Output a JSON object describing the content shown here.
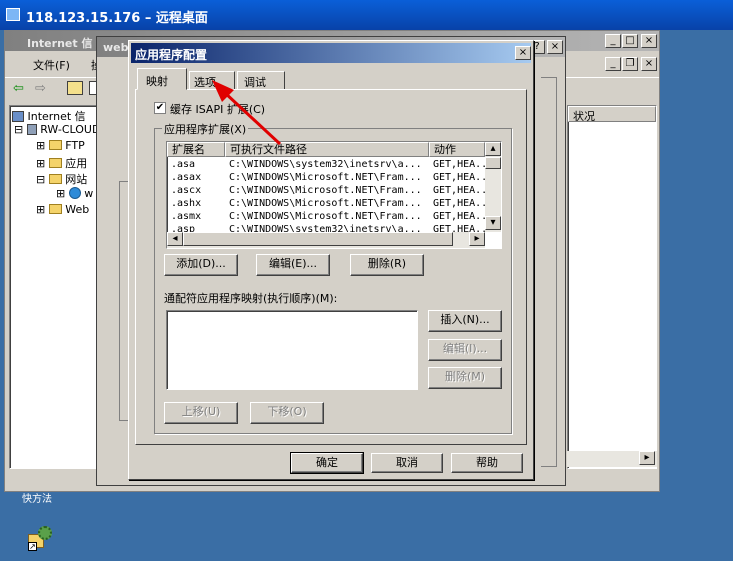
{
  "rdp": {
    "title": "118.123.15.176 – 远程桌面"
  },
  "iis": {
    "title": "Internet 信",
    "menu": {
      "file": "文件(F)",
      "action": "操"
    },
    "tree": [
      {
        "label": "Internet 信"
      },
      {
        "label": "RW-CLOUD"
      },
      {
        "label": "FTP"
      },
      {
        "label": "应用"
      },
      {
        "label": "网站"
      },
      {
        "label": "w"
      },
      {
        "label": "Web"
      }
    ],
    "status_col": "状况"
  },
  "props": {
    "title": "web"
  },
  "desktop": {
    "icon_label": "快方法"
  },
  "dialog": {
    "title": "应用程序配置",
    "tabs": [
      {
        "label": "映射"
      },
      {
        "label": "选项"
      },
      {
        "label": "调试"
      }
    ],
    "cache_label": "缓存 ISAPI 扩展(C)",
    "ext_group": "应用程序扩展(X)",
    "columns": {
      "ext": "扩展名",
      "path": "可执行文件路径",
      "verb": "动作"
    },
    "rows": [
      {
        "ext": ".asa",
        "path": "C:\\WINDOWS\\system32\\inetsrv\\a...",
        "verb": "GET,HEA..."
      },
      {
        "ext": ".asax",
        "path": "C:\\WINDOWS\\Microsoft.NET\\Fram...",
        "verb": "GET,HEA..."
      },
      {
        "ext": ".ascx",
        "path": "C:\\WINDOWS\\Microsoft.NET\\Fram...",
        "verb": "GET,HEA..."
      },
      {
        "ext": ".ashx",
        "path": "C:\\WINDOWS\\Microsoft.NET\\Fram...",
        "verb": "GET,HEA..."
      },
      {
        "ext": ".asmx",
        "path": "C:\\WINDOWS\\Microsoft.NET\\Fram...",
        "verb": "GET,HEA..."
      },
      {
        "ext": ".asp",
        "path": "C:\\WINDOWS\\system32\\inetsrv\\a...",
        "verb": "GET,HEA..."
      }
    ],
    "buttons": {
      "add": "添加(D)...",
      "edit": "编辑(E)...",
      "remove": "删除(R)",
      "wildcard_label": "通配符应用程序映射(执行顺序)(M):",
      "insert": "插入(N)...",
      "edit2": "编辑(I)...",
      "remove2": "删除(M)",
      "move_up": "上移(U)",
      "move_down": "下移(O)",
      "ok": "确定",
      "cancel": "取消",
      "help": "帮助"
    }
  }
}
